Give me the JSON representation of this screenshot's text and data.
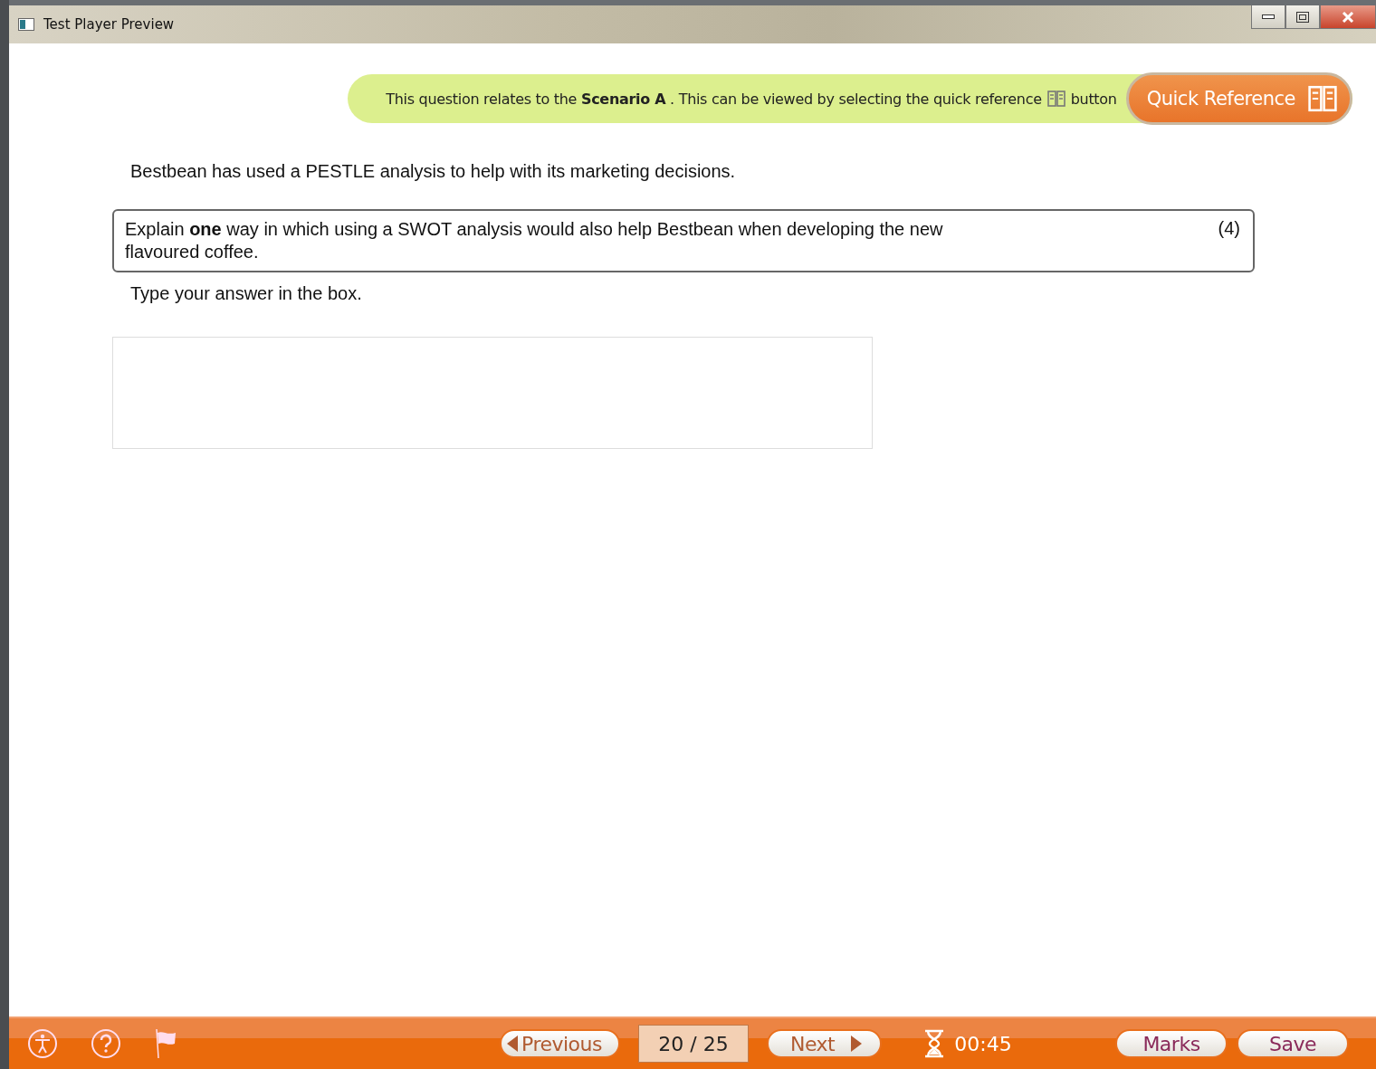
{
  "window": {
    "title": "Test Player Preview"
  },
  "banner": {
    "text": "This question relates to the **Scenario A** . This can be viewed by selecting the quick reference",
    "text_after_icon": "button",
    "button": "Quick Reference"
  },
  "context": "Bestbean has used a PESTLE analysis to help with its marketing decisions.",
  "question": {
    "text": "Explain **one** way in which using a SWOT analysis would also help Bestbean when developing the new flavoured coffee.",
    "marks": "(4)"
  },
  "instruction": "Type your answer in the box.",
  "footer": {
    "previous": "Previous",
    "counter": "20 / 25",
    "next": "Next",
    "timer": "00:45",
    "marks": "Marks",
    "save": "Save"
  }
}
